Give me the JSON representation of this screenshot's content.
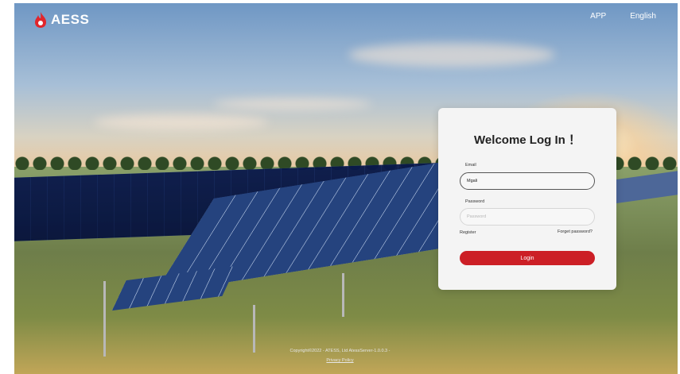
{
  "brand": {
    "name": "AESS",
    "logo_icon": "flame-logo-icon",
    "accent_color": "#cc1f26"
  },
  "nav": {
    "app_label": "APP",
    "language_label": "English"
  },
  "login": {
    "title": "Welcome Log In ！",
    "email_label": "Email",
    "email_value": "Mgali",
    "password_label": "Password",
    "password_placeholder": "Password",
    "register_label": "Register",
    "forgot_label": "Forget password?",
    "login_button": "Login"
  },
  "footer": {
    "copyright": "Copyright©2022 - ATESS, Ltd AtessServer-1.0.0.3 -",
    "privacy": "Privacy Policy"
  }
}
